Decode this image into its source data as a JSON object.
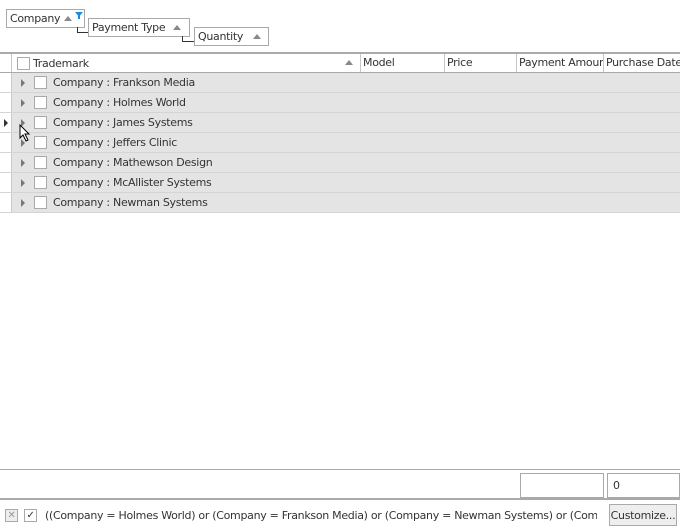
{
  "group_panel": {
    "items": [
      {
        "label": "Company",
        "filtered": true
      },
      {
        "label": "Payment Type"
      },
      {
        "label": "Quantity"
      }
    ]
  },
  "columns": [
    "Trademark",
    "Model",
    "Price",
    "Payment Amount",
    "Purchase Date"
  ],
  "rows": [
    "Company : Frankson Media",
    "Company : Holmes World",
    "Company : James Systems",
    "Company : Jeffers Clinic",
    "Company : Mathewson Design",
    "Company : McAllister Systems",
    "Company : Newman Systems"
  ],
  "summary": {
    "box1": "",
    "box2": "0"
  },
  "filter": {
    "text": "((Company = Holmes World) or (Company = Frankson Media) or (Company = Newman Systems) or (Company = Jar",
    "customize_label": "Customize...",
    "enabled": true
  },
  "colors": {
    "accent": "#1e88e5",
    "row_bg": "#e4e4e4"
  }
}
